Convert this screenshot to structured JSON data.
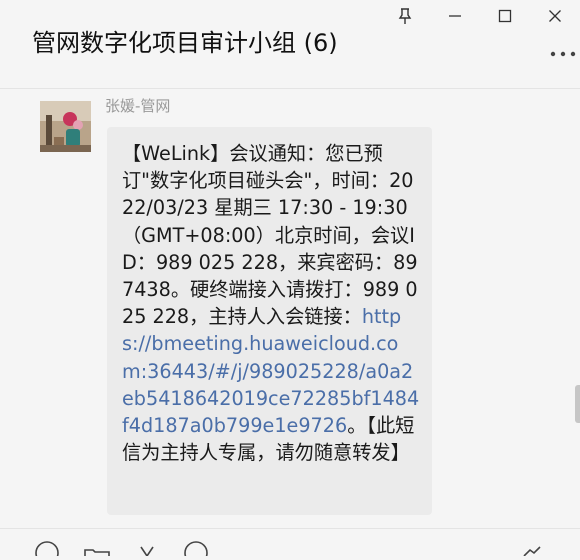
{
  "window": {
    "title": "管网数字化项目审计小组 (6)"
  },
  "message": {
    "sender": "张媛-管网",
    "text_before_link": "【WeLink】会议通知：您已预订\"数字化项目碰头会\"，时间：2022/03/23 星期三 17:30 - 19:30 （GMT+08:00）北京时间，会议ID：989 025 228，来宾密码：897438。硬终端接入请拨打：989 025 228，主持人入会链接：",
    "link": "https://bmeeting.huaweicloud.com:36443/#/j/989025228/a0a2eb5418642019ce72285bf1484f4d187a0b799e1e9726",
    "text_after_link": "。【此短信为主持人专属，请勿随意转发】"
  },
  "colors": {
    "background": "#f5f5f5",
    "bubble": "#ebebeb",
    "link": "#4a6ea8",
    "sender": "#9a9a9a"
  },
  "icons": [
    "pin-icon",
    "minimize-icon",
    "maximize-icon",
    "close-icon",
    "more-icon",
    "emoji-icon",
    "folder-icon",
    "scissors-icon",
    "history-icon",
    "call-icon"
  ]
}
